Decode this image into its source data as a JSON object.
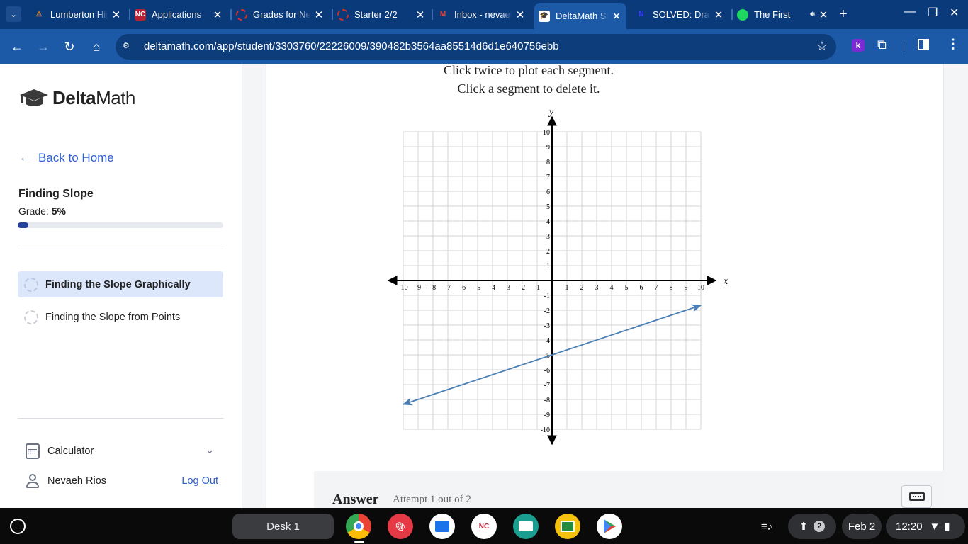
{
  "browser": {
    "tabs": [
      {
        "title": "Lumberton High",
        "icon": "lumberton-icon",
        "color": "#e07b1a"
      },
      {
        "title": "Applications",
        "icon": "ncedcloud-icon",
        "color": "#c0392b"
      },
      {
        "title": "Grades for Nevaeh",
        "icon": "powerschool-icon",
        "color": "#d93025"
      },
      {
        "title": "Starter 2/2",
        "icon": "powerschool-icon",
        "color": "#d93025"
      },
      {
        "title": "Inbox - nevaeh",
        "icon": "gmail-icon",
        "color": "#ea4335"
      },
      {
        "title": "DeltaMath Student",
        "icon": "deltamath-icon",
        "color": "#ffffff"
      },
      {
        "title": "SOLVED: Draw",
        "icon": "numerade-icon",
        "color": "#3b3bff"
      },
      {
        "title": "The First",
        "icon": "spotify-icon",
        "color": "#1ed760"
      }
    ],
    "active_tab_index": 5,
    "url": "deltamath.com/app/student/3303760/22226009/390482b3564aa85514d6d1e640756ebb",
    "extension_letter": "k"
  },
  "sidebar": {
    "logo_text_bold": "Delta",
    "logo_text_rest": "Math",
    "back_label": "Back to Home",
    "assignment_title": "Finding Slope",
    "grade_label": "Grade: ",
    "grade_value": "5%",
    "grade_fraction": 0.05,
    "skills": [
      {
        "label": "Finding the Slope Graphically",
        "active": true
      },
      {
        "label": "Finding the Slope from Points",
        "active": false
      }
    ],
    "calculator_label": "Calculator",
    "user_name": "Nevaeh Rios",
    "logout_label": "Log Out"
  },
  "main": {
    "instruction_1": "Click twice to plot each segment.",
    "instruction_2": "Click a segment to delete it.",
    "answer_label": "Answer",
    "attempt_label": "Attempt 1 out of 2"
  },
  "chart_data": {
    "type": "line",
    "xlabel": "x",
    "ylabel": "y",
    "xlim": [
      -10,
      10
    ],
    "ylim": [
      -10,
      10
    ],
    "xticks": [
      -10,
      -9,
      -8,
      -7,
      -6,
      -5,
      -4,
      -3,
      -2,
      -1,
      1,
      2,
      3,
      4,
      5,
      6,
      7,
      8,
      9,
      10
    ],
    "yticks": [
      -10,
      -9,
      -8,
      -7,
      -6,
      -5,
      -4,
      -3,
      -2,
      -1,
      1,
      2,
      3,
      4,
      5,
      6,
      7,
      8,
      9,
      10
    ],
    "grid": true,
    "line": {
      "x": [
        -10,
        10
      ],
      "y": [
        -8.33,
        -1.67
      ],
      "color": "#4a7fb5",
      "arrows": "both"
    }
  },
  "shelf": {
    "desk_label": "Desk 1",
    "apps": [
      {
        "name": "chrome-icon",
        "color": "#ffffff"
      },
      {
        "name": "canvas-icon",
        "color": "#e63946"
      },
      {
        "name": "files-icon",
        "color": "#ffffff"
      },
      {
        "name": "ncedcloud-icon",
        "color": "#ffffff"
      },
      {
        "name": "classroom-icon",
        "color": "#1a9e8f"
      },
      {
        "name": "google-classroom-icon",
        "color": "#f4c20d"
      },
      {
        "name": "play-store-icon",
        "color": "#ffffff"
      }
    ],
    "notification_count": "2",
    "date": "Feb 2",
    "time": "12:20"
  }
}
